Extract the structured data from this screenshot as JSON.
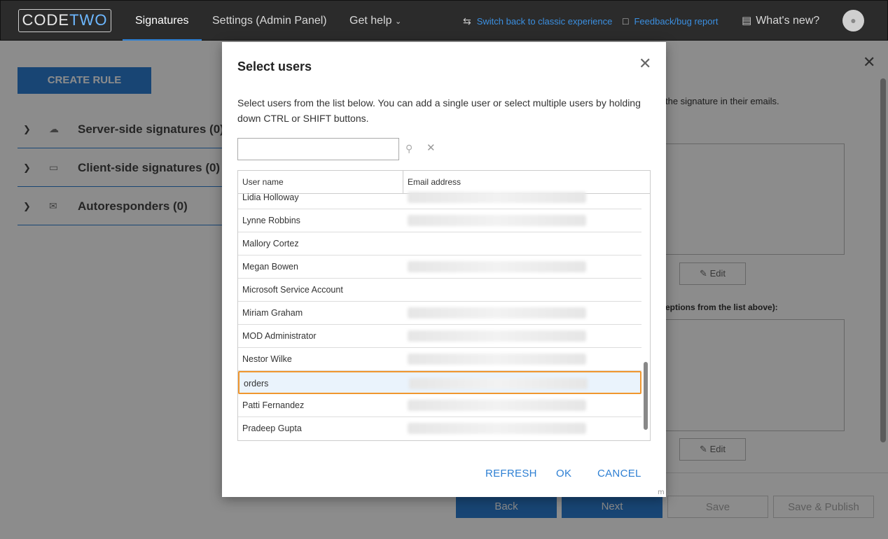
{
  "topbar": {
    "logo_a": "CODE",
    "logo_b": "TWO",
    "tabs": [
      {
        "label": "Signatures"
      },
      {
        "label": "Settings (Admin Panel)"
      },
      {
        "label": "Get help"
      }
    ],
    "switch_link": "Switch back to classic experience",
    "feedback_link": "Feedback/bug report",
    "whats_new": "What's new?",
    "accent": "#2d7fd3"
  },
  "sidebar": {
    "create_rule": "CREATE RULE",
    "items": [
      {
        "label": "Server-side signatures (0)",
        "icon": "cloud-icon"
      },
      {
        "label": "Client-side signatures (0)",
        "icon": "monitor-icon"
      },
      {
        "label": "Autoresponders (0)",
        "icon": "autoresponder-icon"
      }
    ]
  },
  "background_panel": {
    "text1": "the signature in their emails.",
    "text2": "eptions from the list above):",
    "edit_label": "Edit",
    "back": "Back",
    "next": "Next",
    "save": "Save",
    "save_publish": "Save & Publish"
  },
  "modal": {
    "title": "Select users",
    "description": "Select users from the list below. You can add a single user or select multiple users by holding down CTRL or SHIFT buttons.",
    "search_value": "",
    "columns": [
      "User name",
      "Email address"
    ],
    "rows": [
      {
        "name": "Lidia Holloway",
        "has_email": true
      },
      {
        "name": "Lynne Robbins",
        "has_email": true
      },
      {
        "name": "Mallory Cortez",
        "has_email": false
      },
      {
        "name": "Megan Bowen",
        "has_email": true
      },
      {
        "name": "Microsoft Service Account",
        "has_email": false
      },
      {
        "name": "Miriam Graham",
        "has_email": true
      },
      {
        "name": "MOD Administrator",
        "has_email": true
      },
      {
        "name": "Nestor Wilke",
        "has_email": true
      },
      {
        "name": "orders",
        "has_email": true,
        "selected": true
      },
      {
        "name": "Patti Fernandez",
        "has_email": true
      },
      {
        "name": "Pradeep Gupta",
        "has_email": true
      }
    ],
    "refresh": "REFRESH",
    "ok": "OK",
    "cancel": "CANCEL",
    "highlight_color": "#f0972f"
  }
}
